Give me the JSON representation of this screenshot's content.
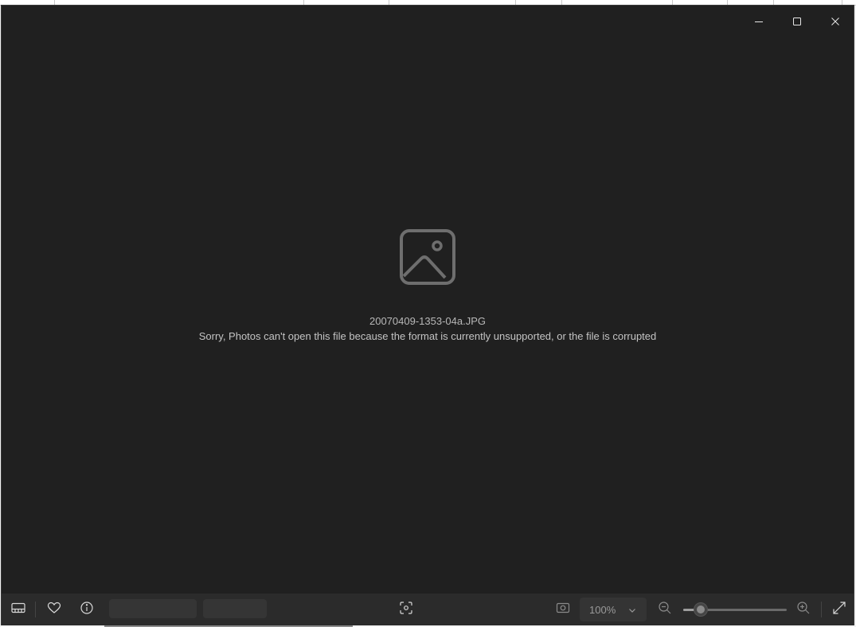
{
  "window": {
    "file_name": "20070409-1353-04a.JPG",
    "error_message": "Sorry, Photos can't open this file because the format is currently unsupported, or the file is corrupted",
    "caption_buttons": {
      "minimize": "minimize-icon",
      "maximize": "maximize-icon",
      "close": "close-icon"
    }
  },
  "toolbar": {
    "filmstrip_icon": "filmstrip-icon",
    "favorite_icon": "heart-icon",
    "info_icon": "info-icon",
    "scan_icon": "scan-icon",
    "actual_size_icon": "actual-size-icon",
    "zoom": {
      "value": "100%",
      "slider_fraction": 0.17
    },
    "zoom_out_icon": "zoom-out-icon",
    "zoom_in_icon": "zoom-in-icon",
    "fullscreen_icon": "fullscreen-icon"
  },
  "colors": {
    "window_bg": "#202020",
    "toolbar_bg": "#2b2b2b",
    "icon_gray": "#6e6e6e",
    "text_gray": "#b8b8b8"
  }
}
